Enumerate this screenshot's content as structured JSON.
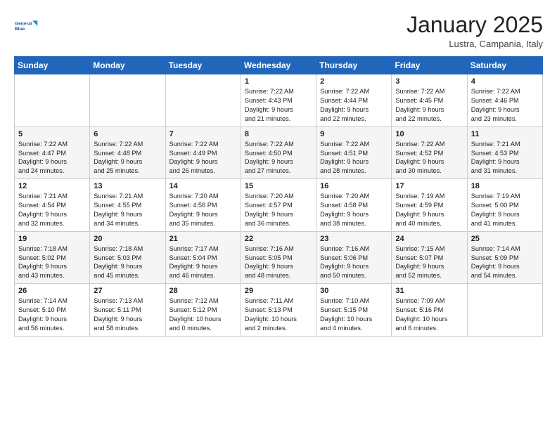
{
  "header": {
    "logo_line1": "General",
    "logo_line2": "Blue",
    "month": "January 2025",
    "location": "Lustra, Campania, Italy"
  },
  "weekdays": [
    "Sunday",
    "Monday",
    "Tuesday",
    "Wednesday",
    "Thursday",
    "Friday",
    "Saturday"
  ],
  "weeks": [
    [
      {
        "day": "",
        "text": ""
      },
      {
        "day": "",
        "text": ""
      },
      {
        "day": "",
        "text": ""
      },
      {
        "day": "1",
        "text": "Sunrise: 7:22 AM\nSunset: 4:43 PM\nDaylight: 9 hours\nand 21 minutes."
      },
      {
        "day": "2",
        "text": "Sunrise: 7:22 AM\nSunset: 4:44 PM\nDaylight: 9 hours\nand 22 minutes."
      },
      {
        "day": "3",
        "text": "Sunrise: 7:22 AM\nSunset: 4:45 PM\nDaylight: 9 hours\nand 22 minutes."
      },
      {
        "day": "4",
        "text": "Sunrise: 7:22 AM\nSunset: 4:46 PM\nDaylight: 9 hours\nand 23 minutes."
      }
    ],
    [
      {
        "day": "5",
        "text": "Sunrise: 7:22 AM\nSunset: 4:47 PM\nDaylight: 9 hours\nand 24 minutes."
      },
      {
        "day": "6",
        "text": "Sunrise: 7:22 AM\nSunset: 4:48 PM\nDaylight: 9 hours\nand 25 minutes."
      },
      {
        "day": "7",
        "text": "Sunrise: 7:22 AM\nSunset: 4:49 PM\nDaylight: 9 hours\nand 26 minutes."
      },
      {
        "day": "8",
        "text": "Sunrise: 7:22 AM\nSunset: 4:50 PM\nDaylight: 9 hours\nand 27 minutes."
      },
      {
        "day": "9",
        "text": "Sunrise: 7:22 AM\nSunset: 4:51 PM\nDaylight: 9 hours\nand 28 minutes."
      },
      {
        "day": "10",
        "text": "Sunrise: 7:22 AM\nSunset: 4:52 PM\nDaylight: 9 hours\nand 30 minutes."
      },
      {
        "day": "11",
        "text": "Sunrise: 7:21 AM\nSunset: 4:53 PM\nDaylight: 9 hours\nand 31 minutes."
      }
    ],
    [
      {
        "day": "12",
        "text": "Sunrise: 7:21 AM\nSunset: 4:54 PM\nDaylight: 9 hours\nand 32 minutes."
      },
      {
        "day": "13",
        "text": "Sunrise: 7:21 AM\nSunset: 4:55 PM\nDaylight: 9 hours\nand 34 minutes."
      },
      {
        "day": "14",
        "text": "Sunrise: 7:20 AM\nSunset: 4:56 PM\nDaylight: 9 hours\nand 35 minutes."
      },
      {
        "day": "15",
        "text": "Sunrise: 7:20 AM\nSunset: 4:57 PM\nDaylight: 9 hours\nand 36 minutes."
      },
      {
        "day": "16",
        "text": "Sunrise: 7:20 AM\nSunset: 4:58 PM\nDaylight: 9 hours\nand 38 minutes."
      },
      {
        "day": "17",
        "text": "Sunrise: 7:19 AM\nSunset: 4:59 PM\nDaylight: 9 hours\nand 40 minutes."
      },
      {
        "day": "18",
        "text": "Sunrise: 7:19 AM\nSunset: 5:00 PM\nDaylight: 9 hours\nand 41 minutes."
      }
    ],
    [
      {
        "day": "19",
        "text": "Sunrise: 7:18 AM\nSunset: 5:02 PM\nDaylight: 9 hours\nand 43 minutes."
      },
      {
        "day": "20",
        "text": "Sunrise: 7:18 AM\nSunset: 5:03 PM\nDaylight: 9 hours\nand 45 minutes."
      },
      {
        "day": "21",
        "text": "Sunrise: 7:17 AM\nSunset: 5:04 PM\nDaylight: 9 hours\nand 46 minutes."
      },
      {
        "day": "22",
        "text": "Sunrise: 7:16 AM\nSunset: 5:05 PM\nDaylight: 9 hours\nand 48 minutes."
      },
      {
        "day": "23",
        "text": "Sunrise: 7:16 AM\nSunset: 5:06 PM\nDaylight: 9 hours\nand 50 minutes."
      },
      {
        "day": "24",
        "text": "Sunrise: 7:15 AM\nSunset: 5:07 PM\nDaylight: 9 hours\nand 52 minutes."
      },
      {
        "day": "25",
        "text": "Sunrise: 7:14 AM\nSunset: 5:09 PM\nDaylight: 9 hours\nand 54 minutes."
      }
    ],
    [
      {
        "day": "26",
        "text": "Sunrise: 7:14 AM\nSunset: 5:10 PM\nDaylight: 9 hours\nand 56 minutes."
      },
      {
        "day": "27",
        "text": "Sunrise: 7:13 AM\nSunset: 5:11 PM\nDaylight: 9 hours\nand 58 minutes."
      },
      {
        "day": "28",
        "text": "Sunrise: 7:12 AM\nSunset: 5:12 PM\nDaylight: 10 hours\nand 0 minutes."
      },
      {
        "day": "29",
        "text": "Sunrise: 7:11 AM\nSunset: 5:13 PM\nDaylight: 10 hours\nand 2 minutes."
      },
      {
        "day": "30",
        "text": "Sunrise: 7:10 AM\nSunset: 5:15 PM\nDaylight: 10 hours\nand 4 minutes."
      },
      {
        "day": "31",
        "text": "Sunrise: 7:09 AM\nSunset: 5:16 PM\nDaylight: 10 hours\nand 6 minutes."
      },
      {
        "day": "",
        "text": ""
      }
    ]
  ]
}
